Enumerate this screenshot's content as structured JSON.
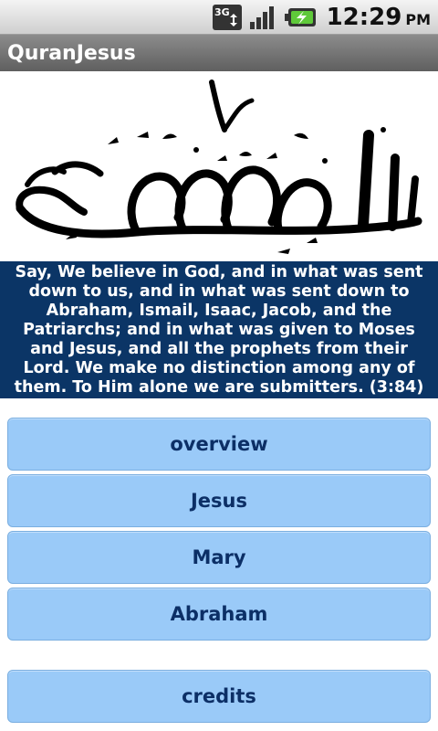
{
  "status_bar": {
    "network_icon": "3g-data-icon",
    "signal_icon": "signal-strength-icon",
    "battery_icon": "battery-charging-icon",
    "time": "12:29",
    "ampm": "PM"
  },
  "app": {
    "title": "QuranJesus"
  },
  "header_image": {
    "icon": "arabic-calligraphy-alhamd-image"
  },
  "verse": {
    "text": "Say, We believe in God, and in what was sent down to us, and in what was sent down to Abraham, Ismail, Isaac, Jacob, and the Patriarchs; and in what was given to Moses and Jesus, and all the prophets from their Lord. We make no distinction among any of them. To Him alone we are submitters. (3:84)"
  },
  "menu": {
    "overview": "overview",
    "jesus": "Jesus",
    "mary": "Mary",
    "abraham": "Abraham",
    "credits": "credits"
  },
  "colors": {
    "verse_bg": "#0b3566",
    "button_bg": "#9acaf8",
    "button_text": "#0c2f66"
  }
}
